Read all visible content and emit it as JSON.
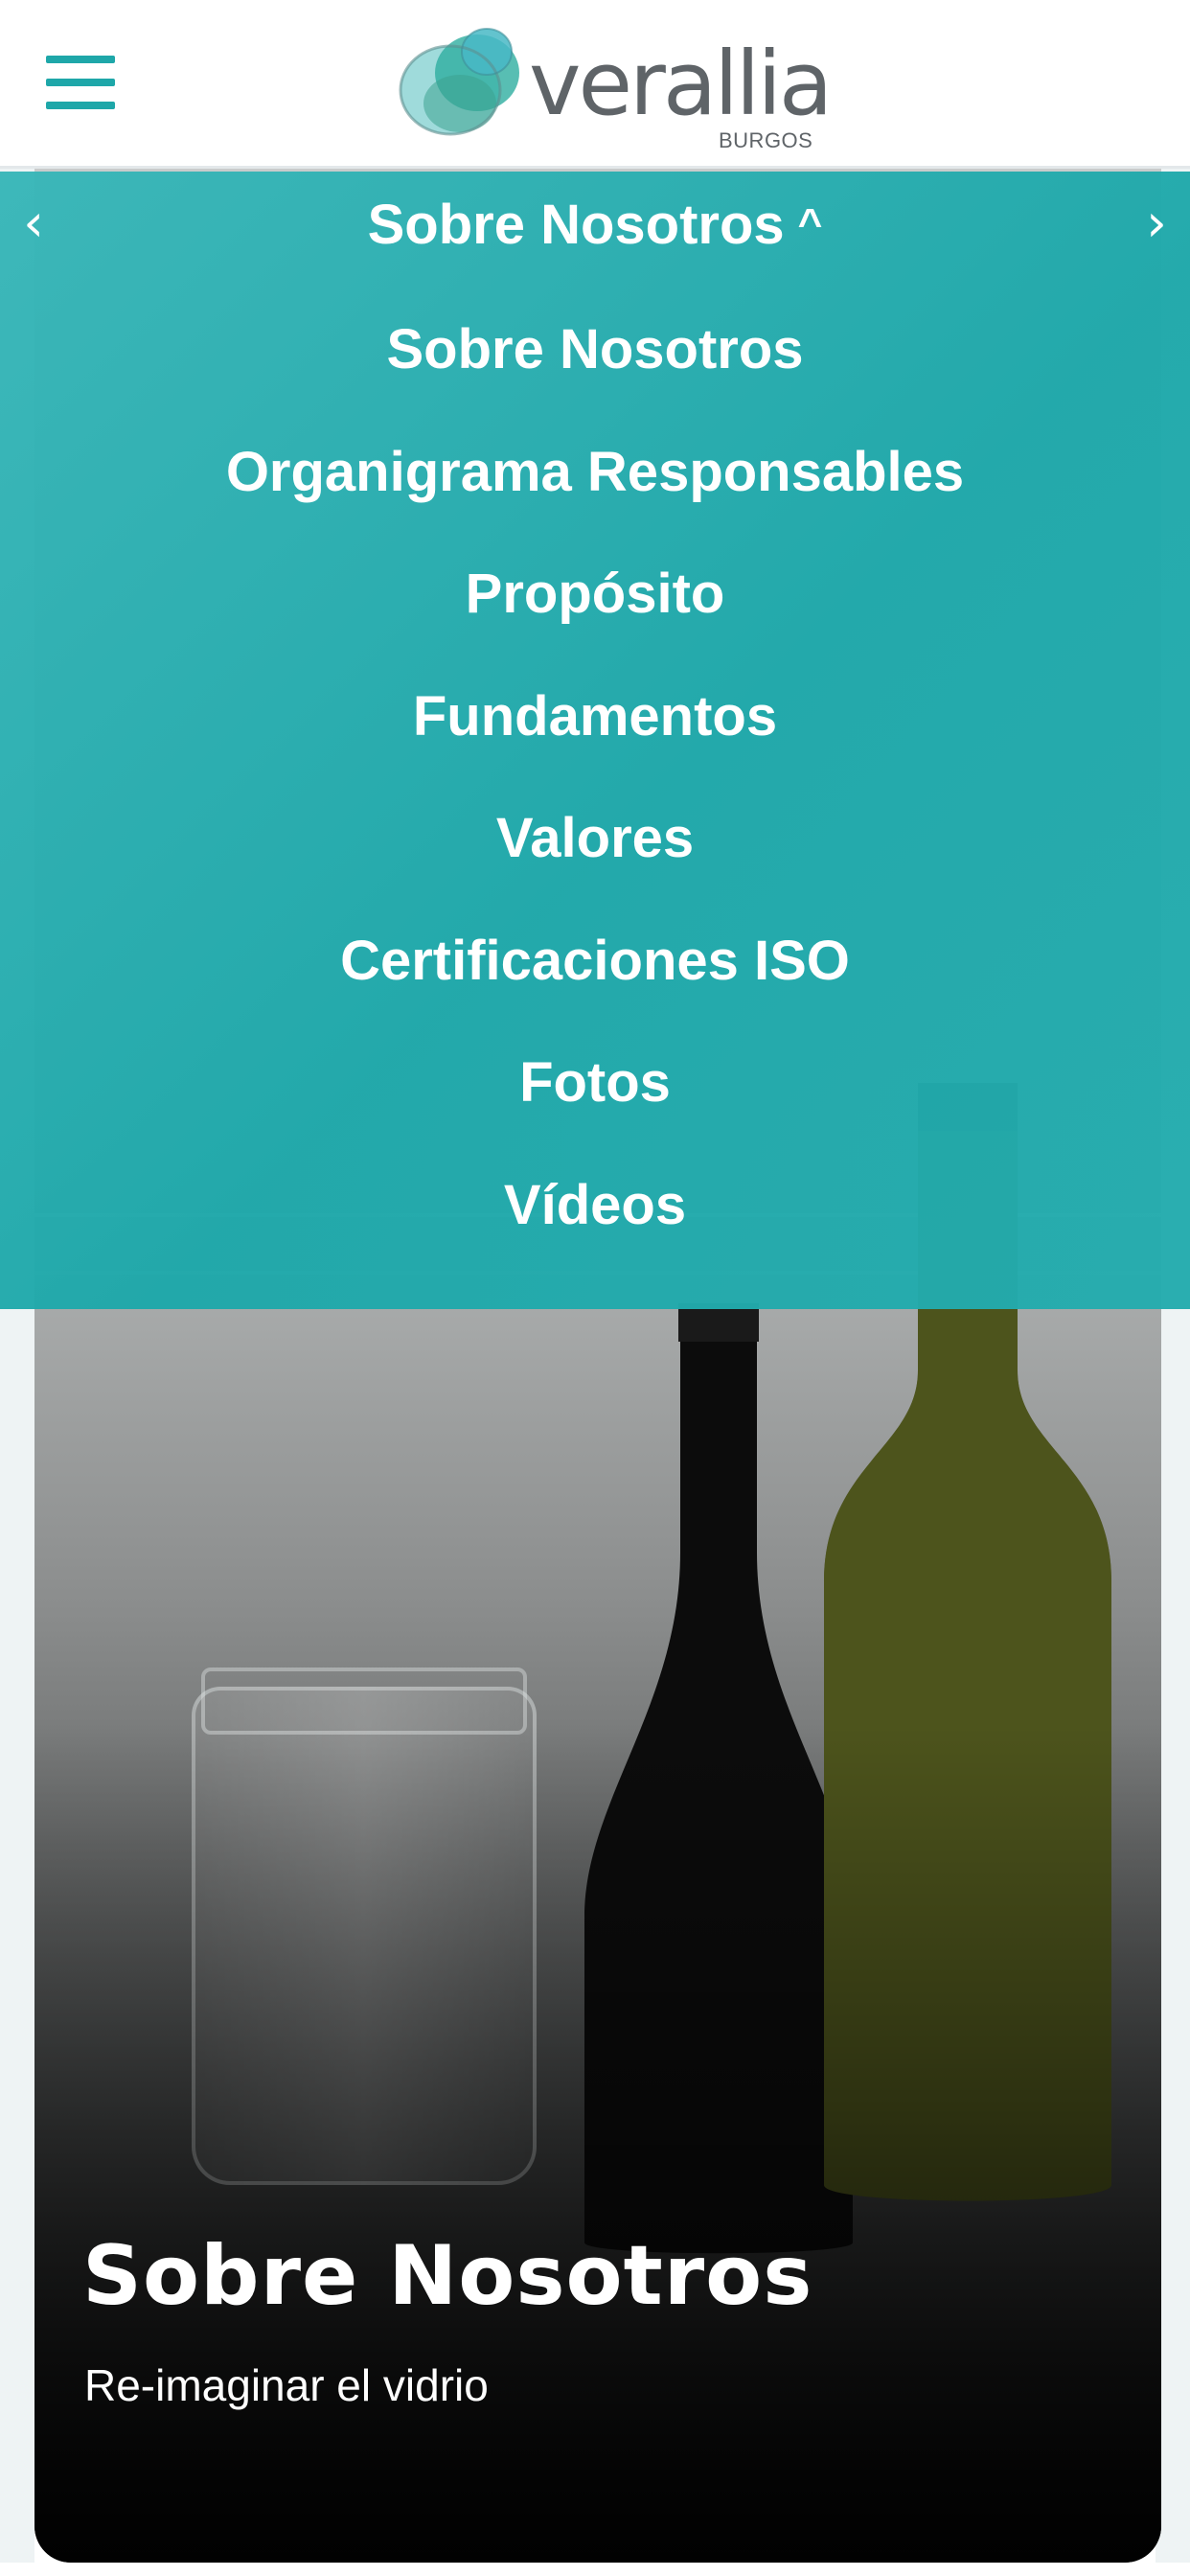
{
  "header": {
    "menu_icon": "hamburger-menu-icon",
    "logo": {
      "brand": "verallia",
      "sub": "BURGOS"
    },
    "accent_color": "#1ea7a9"
  },
  "dropdown": {
    "current": "Sobre Nosotros",
    "caret_icon": "chevron-up-icon",
    "prev_icon": "chevron-left-icon",
    "next_icon": "chevron-right-icon",
    "items": [
      {
        "label": "Sobre Nosotros"
      },
      {
        "label": "Organigrama Responsables"
      },
      {
        "label": "Propósito"
      },
      {
        "label": "Fundamentos"
      },
      {
        "label": "Valores"
      },
      {
        "label": "Certificaciones ISO"
      },
      {
        "label": "Fotos"
      },
      {
        "label": "Vídeos"
      }
    ],
    "background_color": "#1ea8aa"
  },
  "hero": {
    "title": "Sobre Nosotros",
    "subtitle": "Re-imaginar el vidrio"
  }
}
